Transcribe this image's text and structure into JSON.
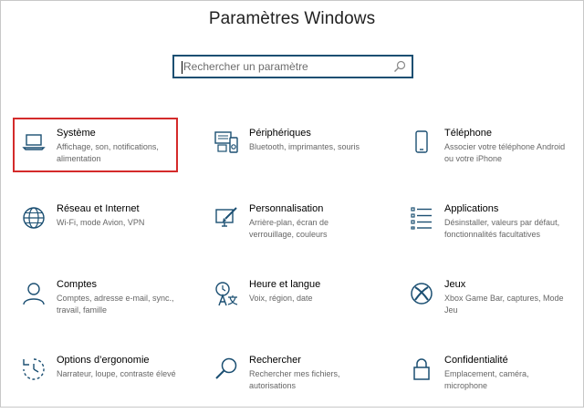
{
  "window": {
    "title": "Paramètres Windows"
  },
  "search": {
    "placeholder": "Rechercher un paramètre",
    "icon": "search-icon"
  },
  "accent_color": "#1b4f72",
  "highlight_color": "#d42b2b",
  "tiles": [
    {
      "name": "Système",
      "desc": "Affichage, son, notifications, alimentation",
      "icon": "laptop-icon"
    },
    {
      "name": "Périphériques",
      "desc": "Bluetooth, imprimantes, souris",
      "icon": "devices-icon"
    },
    {
      "name": "Téléphone",
      "desc": "Associer votre téléphone Android ou votre iPhone",
      "icon": "phone-icon"
    },
    {
      "name": "Réseau et Internet",
      "desc": "Wi-Fi, mode Avion, VPN",
      "icon": "globe-icon"
    },
    {
      "name": "Personnalisation",
      "desc": "Arrière-plan, écran de verrouillage, couleurs",
      "icon": "personalization-icon"
    },
    {
      "name": "Applications",
      "desc": "Désinstaller, valeurs par défaut, fonctionnalités facultatives",
      "icon": "apps-list-icon"
    },
    {
      "name": "Comptes",
      "desc": "Comptes, adresse e-mail, sync., travail, famille",
      "icon": "person-icon"
    },
    {
      "name": "Heure et langue",
      "desc": "Voix, région, date",
      "icon": "time-language-icon"
    },
    {
      "name": "Jeux",
      "desc": "Xbox Game Bar, captures, Mode Jeu",
      "icon": "xbox-icon"
    },
    {
      "name": "Options d’ergonomie",
      "desc": "Narrateur, loupe, contraste élevé",
      "icon": "ease-of-access-icon"
    },
    {
      "name": "Rechercher",
      "desc": "Rechercher mes fichiers, autorisations",
      "icon": "search-icon"
    },
    {
      "name": "Confidentialité",
      "desc": "Emplacement, caméra, microphone",
      "icon": "lock-icon"
    }
  ]
}
